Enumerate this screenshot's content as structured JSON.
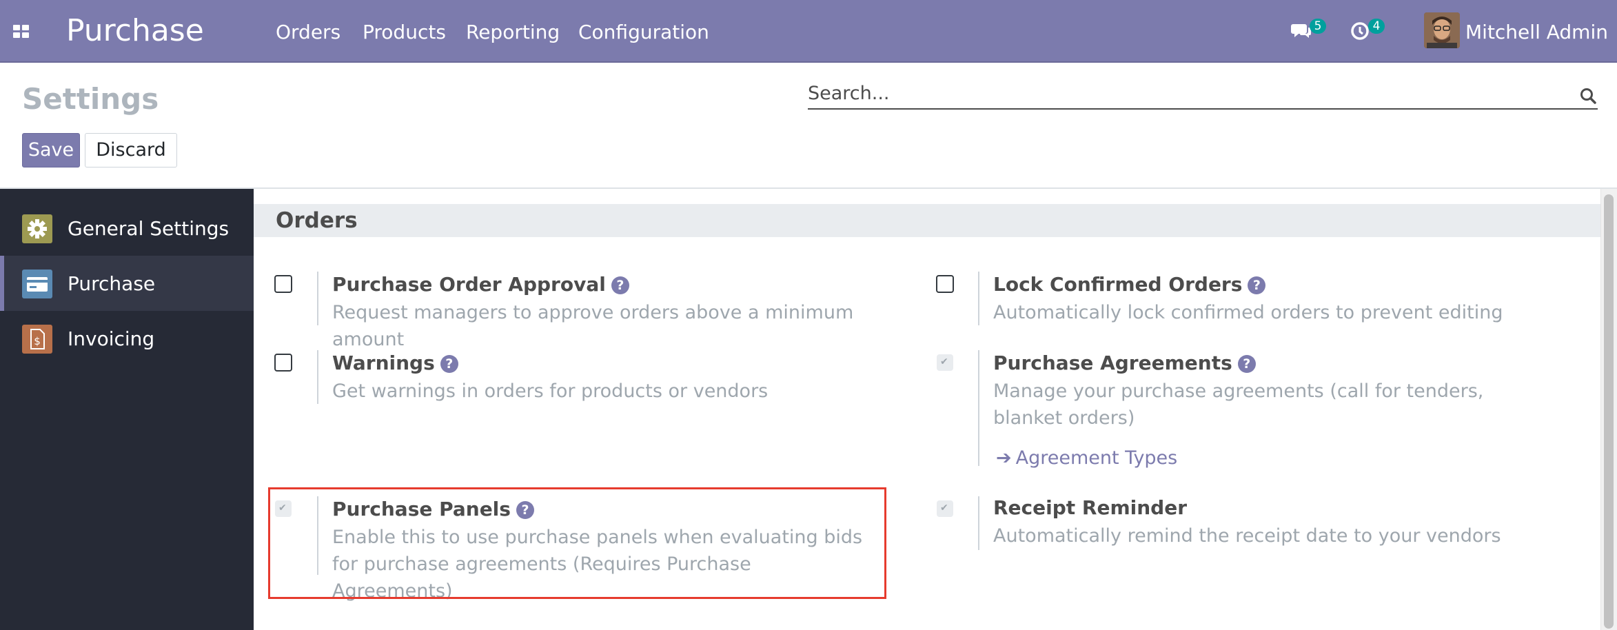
{
  "navbar": {
    "app_title": "Purchase",
    "menu": [
      "Orders",
      "Products",
      "Reporting",
      "Configuration"
    ],
    "messages_count": "5",
    "activities_count": "4",
    "user_name": "Mitchell Admin",
    "brand_color": "#7c7bad"
  },
  "control": {
    "title": "Settings",
    "save_label": "Save",
    "discard_label": "Discard",
    "search_placeholder": "Search..."
  },
  "sidebar": {
    "items": [
      {
        "label": "General Settings",
        "icon": "gear-icon",
        "active": false
      },
      {
        "label": "Purchase",
        "icon": "purchase-card-icon",
        "active": true
      },
      {
        "label": "Invoicing",
        "icon": "invoice-icon",
        "active": false
      }
    ]
  },
  "section": {
    "title": "Orders",
    "settings": [
      {
        "title": "Purchase Order Approval",
        "description": "Request managers to approve orders above a minimum amount",
        "checked": false,
        "help": "?"
      },
      {
        "title": "Lock Confirmed Orders",
        "description": "Automatically lock confirmed orders to prevent editing",
        "checked": false,
        "help": "?"
      },
      {
        "title": "Warnings",
        "description": "Get warnings in orders for products or vendors",
        "checked": false,
        "help": "?"
      },
      {
        "title": "Purchase Agreements",
        "description": "Manage your purchase agreements (call for tenders, blanket orders)",
        "checked": true,
        "help": "?",
        "link": "Agreement Types"
      },
      {
        "title": "Purchase Panels",
        "description": "Enable this to use purchase panels when evaluating bids for purchase agreements (Requires Purchase Agreements)",
        "checked": true,
        "help": "?"
      },
      {
        "title": "Receipt Reminder",
        "description": "Automatically remind the receipt date to your vendors",
        "checked": true
      }
    ]
  }
}
